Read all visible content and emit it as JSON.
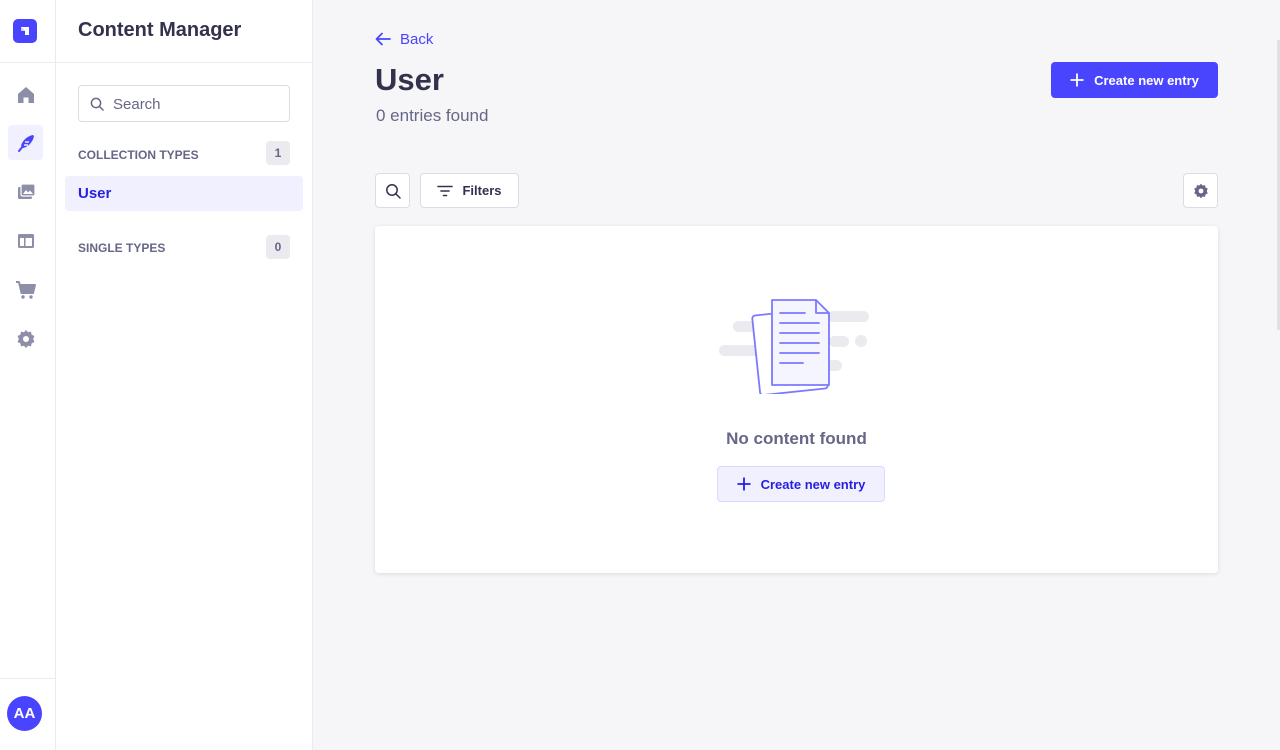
{
  "app": {
    "avatar_initials": "AA",
    "icons": [
      "strapi-logo-icon",
      "home-icon",
      "content-manager-icon",
      "media-library-icon",
      "content-type-builder-icon",
      "marketplace-icon",
      "settings-icon"
    ]
  },
  "sidebar": {
    "title": "Content Manager",
    "search": {
      "placeholder": "Search",
      "value": ""
    },
    "collection_types": {
      "label": "COLLECTION TYPES",
      "count": "1",
      "items": [
        {
          "label": "User",
          "active": true
        }
      ]
    },
    "single_types": {
      "label": "SINGLE TYPES",
      "count": "0"
    }
  },
  "main": {
    "back_label": "Back",
    "title": "User",
    "subtitle": "0 entries found",
    "create_button_label": "Create new entry",
    "filters_label": "Filters",
    "empty_state": {
      "message": "No content found",
      "button_label": "Create new entry"
    }
  },
  "colors": {
    "primary": "#4945ff",
    "primary_light": "#f0f0ff",
    "primary_text": "#271fe0",
    "neutral_text": "#32324d",
    "muted_text": "#666687",
    "background": "#f6f6f9"
  }
}
